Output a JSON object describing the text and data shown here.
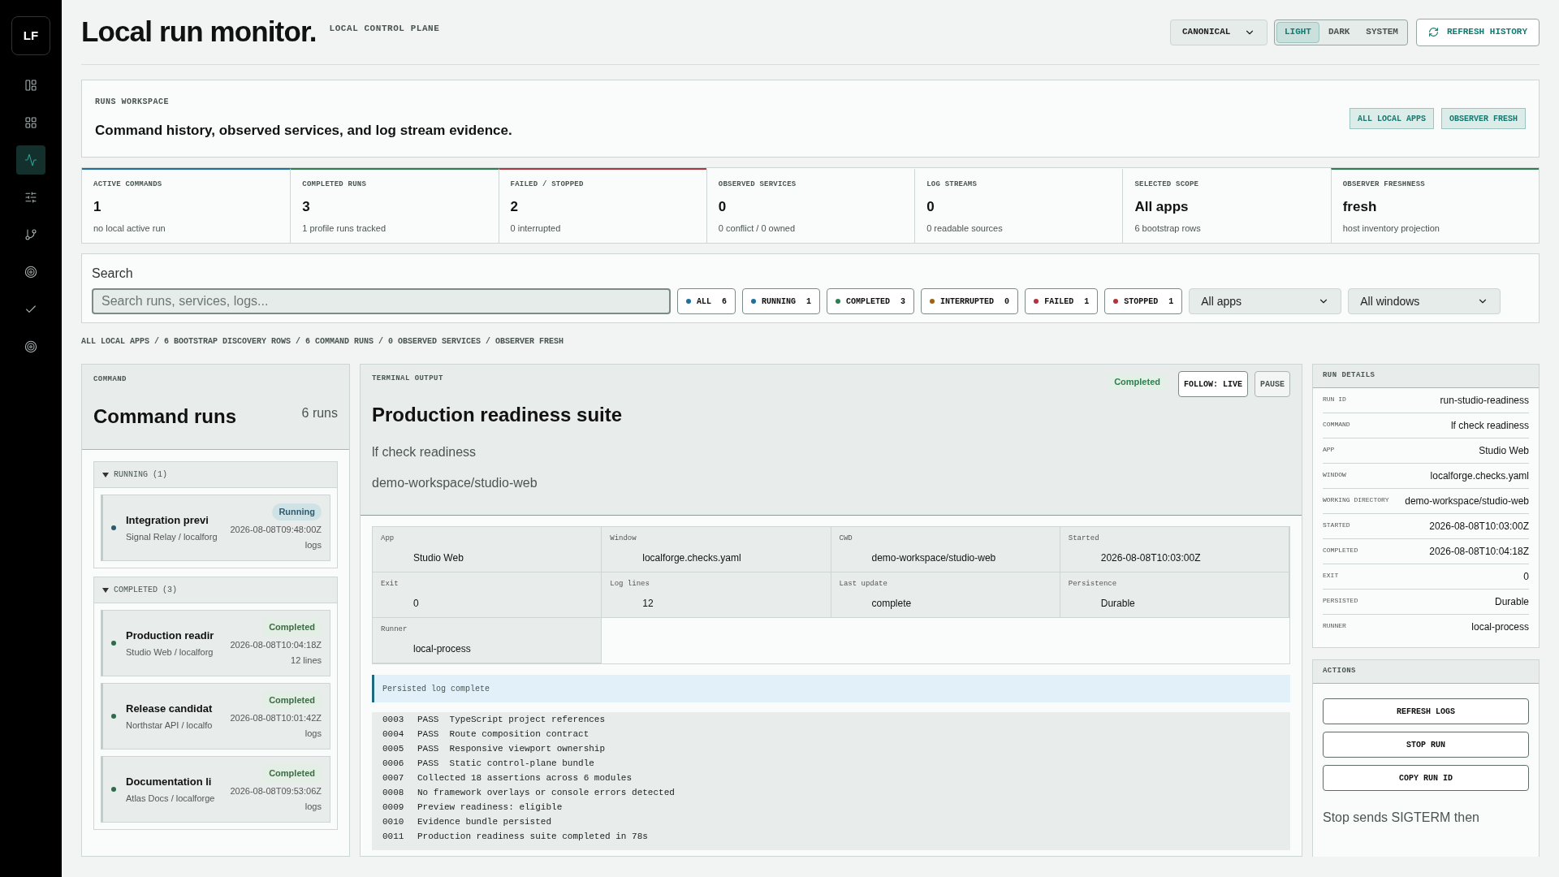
{
  "sidebar": {
    "logo": "LF",
    "items": [
      {
        "kind": "panels",
        "selected": false
      },
      {
        "kind": "grid",
        "selected": false
      },
      {
        "kind": "activity",
        "selected": true
      },
      {
        "kind": "sliders",
        "selected": false
      },
      {
        "kind": "branch",
        "selected": false
      },
      {
        "kind": "target",
        "selected": false
      },
      {
        "kind": "check",
        "selected": false
      },
      {
        "kind": "target",
        "selected": false
      }
    ]
  },
  "header": {
    "title": "Local run monitor.",
    "subtitle": "LOCAL CONTROL PLANE",
    "profile_select": "CANONICAL",
    "themes": [
      {
        "label": "LIGHT",
        "selected": true
      },
      {
        "label": "DARK",
        "selected": false
      },
      {
        "label": "SYSTEM",
        "selected": false
      }
    ],
    "refresh_button": "REFRESH HISTORY"
  },
  "workspace": {
    "eyebrow": "RUNS WORKSPACE",
    "headline": "Command history, observed services, and log stream evidence.",
    "badges": [
      "ALL LOCAL APPS",
      "OBSERVER FRESH"
    ]
  },
  "stats": [
    {
      "label": "ACTIVE COMMANDS",
      "value": "1",
      "note": "no local active run",
      "color": "#1d6fa0"
    },
    {
      "label": "COMPLETED RUNS",
      "value": "3",
      "note": "1 profile runs tracked",
      "color": "#2e7d4f"
    },
    {
      "label": "FAILED / STOPPED",
      "value": "2",
      "note": "0 interrupted",
      "color": "#b3323b"
    },
    {
      "label": "OBSERVED SERVICES",
      "value": "0",
      "note": "0 conflict / 0 owned"
    },
    {
      "label": "LOG STREAMS",
      "value": "0",
      "note": "0 readable sources"
    },
    {
      "label": "SELECTED SCOPE",
      "value": "All apps",
      "note": "6 bootstrap rows"
    },
    {
      "label": "OBSERVER FRESHNESS",
      "value": "fresh",
      "note": "host inventory projection",
      "color": "#2e7d4f"
    }
  ],
  "search": {
    "label": "Search",
    "placeholder": "Search runs, services, logs...",
    "filters": [
      {
        "label": "ALL",
        "count": "6",
        "color": "#1d6fa0"
      },
      {
        "label": "RUNNING",
        "count": "1",
        "color": "#1d6fa0"
      },
      {
        "label": "COMPLETED",
        "count": "3",
        "color": "#2e7d4f"
      },
      {
        "label": "INTERRUPTED",
        "count": "0",
        "color": "#9a6412"
      },
      {
        "label": "FAILED",
        "count": "1",
        "color": "#b3323b"
      },
      {
        "label": "STOPPED",
        "count": "1",
        "color": "#b3323b"
      }
    ],
    "app_select": "All apps",
    "window_select": "All windows"
  },
  "breadcrumb": "ALL LOCAL APPS / 6 BOOTSTRAP DISCOVERY ROWS / 6 COMMAND RUNS / 0 OBSERVED SERVICES / OBSERVER FRESH",
  "command_panel": {
    "eyebrow": "COMMAND",
    "title": "Command runs",
    "count": "6 runs",
    "groups": [
      {
        "label": "RUNNING (1)",
        "expanded": true,
        "runs": [
          {
            "name": "Integration previ",
            "meta": "Signal Relay / localforg",
            "status": "Running",
            "kind": "running",
            "time": "2026-08-08T09:48:00Z",
            "note": "logs",
            "color": "#2f5a6e"
          }
        ]
      },
      {
        "label": "COMPLETED (3)",
        "expanded": true,
        "runs": [
          {
            "name": "Production readir",
            "meta": "Studio Web / localforg",
            "status": "Completed",
            "kind": "completed",
            "time": "2026-08-08T10:04:18Z",
            "note": "12 lines",
            "color": "#2e6b4a"
          },
          {
            "name": "Release candidat",
            "meta": "Northstar API / localfo",
            "status": "Completed",
            "kind": "completed",
            "time": "2026-08-08T10:01:42Z",
            "note": "logs",
            "color": "#2e6b4a"
          },
          {
            "name": "Documentation li",
            "meta": "Atlas Docs / localforge",
            "status": "Completed",
            "kind": "completed",
            "time": "2026-08-08T09:53:06Z",
            "note": "logs",
            "color": "#2e6b4a"
          }
        ]
      }
    ]
  },
  "terminal": {
    "eyebrow": "TERMINAL OUTPUT",
    "status": "Completed",
    "follow_button": "FOLLOW: LIVE",
    "pause_button": "PAUSE",
    "title": "Production readiness suite",
    "command": "lf check readiness",
    "cwd": "demo-workspace/studio-web",
    "fields": [
      {
        "label": "App",
        "value": "Studio Web"
      },
      {
        "label": "Window",
        "value": "localforge.checks.yaml"
      },
      {
        "label": "CWD",
        "value": "demo-workspace/studio-web"
      },
      {
        "label": "Started",
        "value": "2026-08-08T10:03:00Z"
      },
      {
        "label": "Exit",
        "value": "0"
      },
      {
        "label": "Log lines",
        "value": "12"
      },
      {
        "label": "Last update",
        "value": "complete"
      },
      {
        "label": "Persistence",
        "value": "Durable"
      },
      {
        "label": "Runner",
        "value": "local-process"
      }
    ],
    "notice": "Persisted log complete",
    "log": [
      {
        "line": "0003",
        "text": "PASS  TypeScript project references"
      },
      {
        "line": "0004",
        "text": "PASS  Route composition contract"
      },
      {
        "line": "0005",
        "text": "PASS  Responsive viewport ownership"
      },
      {
        "line": "0006",
        "text": "PASS  Static control-plane bundle"
      },
      {
        "line": "0007",
        "text": "Collected 18 assertions across 6 modules"
      },
      {
        "line": "0008",
        "text": "No framework overlays or console errors detected"
      },
      {
        "line": "0009",
        "text": "Preview readiness: eligible"
      },
      {
        "line": "0010",
        "text": "Evidence bundle persisted"
      },
      {
        "line": "0011",
        "text": "Production readiness suite completed in 78s"
      }
    ]
  },
  "run_details": {
    "title": "RUN DETAILS",
    "rows": [
      {
        "label": "RUN ID",
        "value": "run-studio-readiness"
      },
      {
        "label": "COMMAND",
        "value": "lf check readiness"
      },
      {
        "label": "APP",
        "value": "Studio Web"
      },
      {
        "label": "WINDOW",
        "value": "localforge.checks.yaml"
      },
      {
        "label": "WORKING DIRECTORY",
        "value": "demo-workspace/studio-web"
      },
      {
        "label": "STARTED",
        "value": "2026-08-08T10:03:00Z"
      },
      {
        "label": "COMPLETED",
        "value": "2026-08-08T10:04:18Z"
      },
      {
        "label": "EXIT",
        "value": "0"
      },
      {
        "label": "PERSISTED",
        "value": "Durable"
      },
      {
        "label": "RUNNER",
        "value": "local-process"
      }
    ]
  },
  "actions": {
    "title": "ACTIONS",
    "buttons": [
      "REFRESH LOGS",
      "STOP RUN",
      "COPY RUN ID"
    ],
    "note": "Stop sends SIGTERM then"
  }
}
